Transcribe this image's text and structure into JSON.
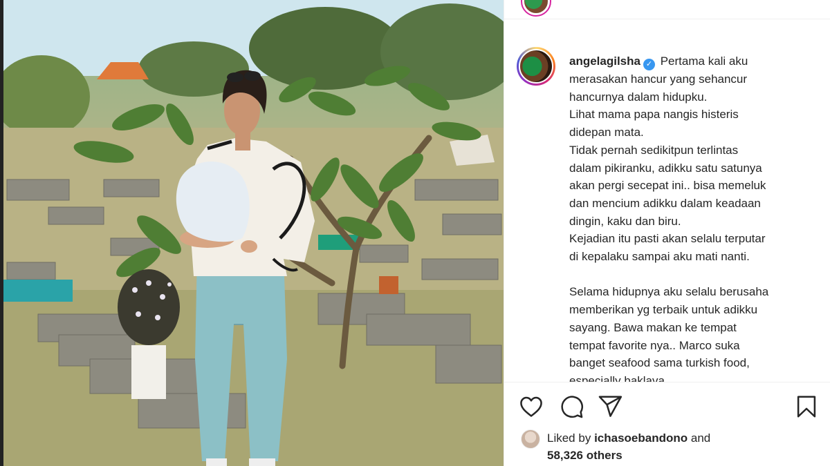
{
  "post": {
    "username": "angelagilsha",
    "verified_icon": "verified-badge-icon",
    "caption_paragraphs": [
      [
        "Pertama kali aku",
        "merasakan hancur yang sehancur",
        "hancurnya dalam hidupku.",
        "Lihat mama papa nangis histeris",
        "didepan mata.",
        "Tidak pernah sedikitpun terlintas",
        "dalam pikiranku, adikku satu satunya",
        "akan pergi secepat ini.. bisa memeluk",
        "dan mencium adikku dalam keadaan",
        "dingin, kaku dan biru.",
        "Kejadian itu pasti akan selalu terputar",
        "di kepalaku sampai aku mati nanti."
      ],
      [
        "Selama hidupnya aku selalu berusaha",
        "memberikan yg terbaik untuk adikku",
        "sayang. Bawa makan ke tempat",
        "tempat favorite nya.. Marco suka",
        "banget seafood sama turkish food,",
        "especially baklava..."
      ]
    ],
    "first_line_rest": "Pertama kali aku",
    "lines_p1": [
      "merasakan hancur yang sehancur",
      "hancurnya dalam hidupku.",
      "Lihat mama papa nangis histeris",
      "didepan mata.",
      "Tidak pernah sedikitpun terlintas",
      "dalam pikiranku, adikku satu satunya",
      "akan pergi secepat ini.. bisa memeluk",
      "dan mencium adikku dalam keadaan",
      "dingin, kaku dan biru.",
      "Kejadian itu pasti akan selalu terputar",
      "di kepalaku sampai aku mati nanti."
    ],
    "lines_p2": [
      "Selama hidupnya aku selalu berusaha",
      "memberikan yg terbaik untuk adikku",
      "sayang. Bawa makan ke tempat",
      "tempat favorite nya.. Marco suka",
      "banget seafood sama turkish food,",
      "especially baklava..."
    ]
  },
  "actions": {
    "like": "heart-icon",
    "comment": "comment-bubble-icon",
    "share": "paper-plane-icon",
    "save": "bookmark-icon"
  },
  "likes": {
    "prefix": "Liked by",
    "user": "ichasoebandono",
    "conjunction": "and",
    "count": "58,326 others"
  },
  "colors": {
    "ring_gradient": [
      "#feda75",
      "#fa7e1e",
      "#d62976",
      "#962fbf",
      "#4f5bd5"
    ],
    "verified": "#3897f0",
    "text": "#262626"
  }
}
